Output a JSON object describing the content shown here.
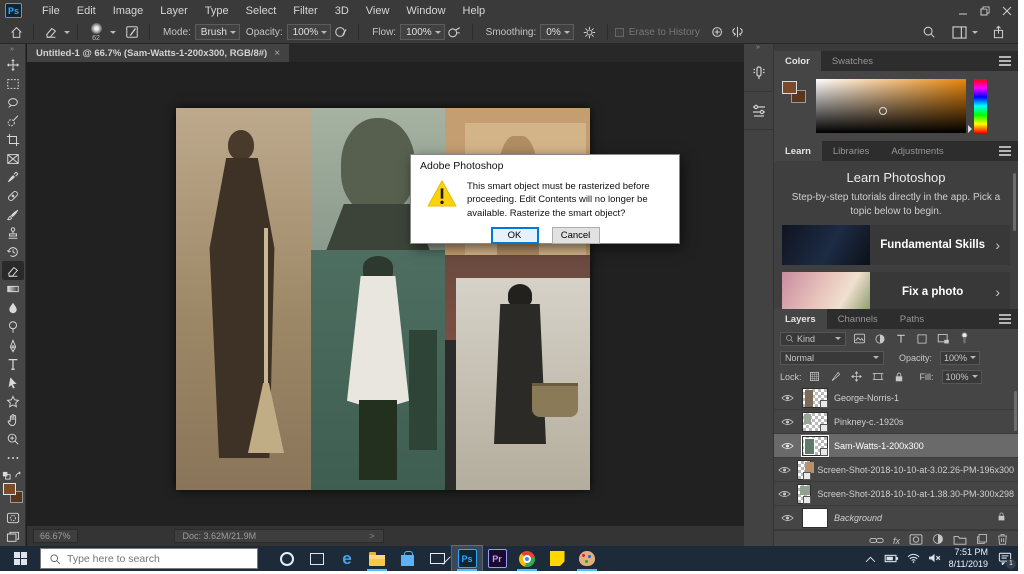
{
  "icons": {
    "close": "×",
    "chevron_right": "›",
    "double_chevron": "»",
    "fx": "fx",
    "greater": ">"
  },
  "titlebar": {
    "app_badge": "Ps",
    "menus": [
      "File",
      "Edit",
      "Image",
      "Layer",
      "Type",
      "Select",
      "Filter",
      "3D",
      "View",
      "Window",
      "Help"
    ]
  },
  "options": {
    "brush_size": "62",
    "mode_label": "Mode:",
    "mode_value": "Brush",
    "opacity_label": "Opacity:",
    "opacity_value": "100%",
    "flow_label": "Flow:",
    "flow_value": "100%",
    "smoothing_label": "Smoothing:",
    "smoothing_value": "0%",
    "erase_history_label": "Erase to History"
  },
  "document_tab": {
    "title": "Untitled-1 @ 66.7% (Sam-Watts-1-200x300, RGB/8#)"
  },
  "dialog": {
    "title": "Adobe Photoshop",
    "message": "This smart object must be rasterized before proceeding.  Edit Contents will no longer be available.  Rasterize the smart object?",
    "ok": "OK",
    "cancel": "Cancel"
  },
  "panels": {
    "color": {
      "tabs": [
        "Color",
        "Swatches"
      ]
    },
    "learn": {
      "tabs": [
        "Learn",
        "Libraries",
        "Adjustments"
      ],
      "heading": "Learn Photoshop",
      "description": "Step-by-step tutorials directly in the app. Pick a topic below to begin.",
      "cards": [
        {
          "label": "Fundamental Skills"
        },
        {
          "label": "Fix a photo"
        }
      ]
    },
    "layers": {
      "tabs": [
        "Layers",
        "Channels",
        "Paths"
      ],
      "kind_label": "Kind",
      "blend_mode": "Normal",
      "opacity_label": "Opacity:",
      "opacity_value": "100%",
      "lock_label": "Lock:",
      "fill_label": "Fill:",
      "fill_value": "100%",
      "layers": [
        "George-Norris-1",
        "Pinkney-c.-1920s",
        "Sam-Watts-1-200x300",
        "Screen-Shot-2018-10-10-at-3.02.26-PM-196x300",
        "Screen-Shot-2018-10-10-at-1.38.30-PM-300x298",
        "Background"
      ],
      "selected_layer": "Sam-Watts-1-200x300"
    }
  },
  "statusbar": {
    "zoom": "66.67%",
    "doc": "Doc: 3.62M/21.9M"
  },
  "taskbar": {
    "search_placeholder": "Type here to search",
    "edge_glyph": "e",
    "ps_glyph": "Ps",
    "pr_glyph": "Pr",
    "time": "7:51 PM",
    "date": "8/11/2019",
    "badge": "1"
  },
  "colors": {
    "ps_blue": "#31a8ff",
    "taskbar_accent": "#4cc2ff",
    "foreground_swatch": "#7a4a2b",
    "background_swatch": "#5a3620",
    "hue_selected": "#e8860c",
    "layer_selected_bg": "#6a6a6a"
  }
}
